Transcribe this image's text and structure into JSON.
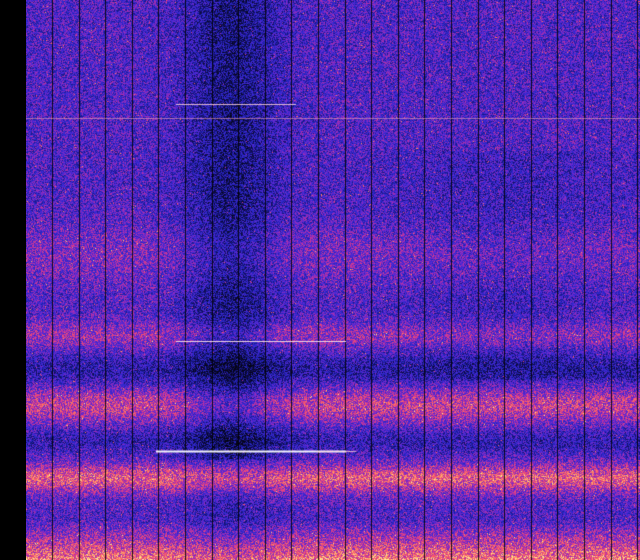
{
  "image": {
    "kind": "spectrogram-waterfall",
    "palette": [
      "#05051a",
      "#1a1a7a",
      "#2a2acf",
      "#6a2ad0",
      "#c0309a",
      "#ff5a5a",
      "#ff9a5a",
      "#ffee99"
    ],
    "left_border_color": "#000000",
    "vertical_grid_lines": 23
  }
}
